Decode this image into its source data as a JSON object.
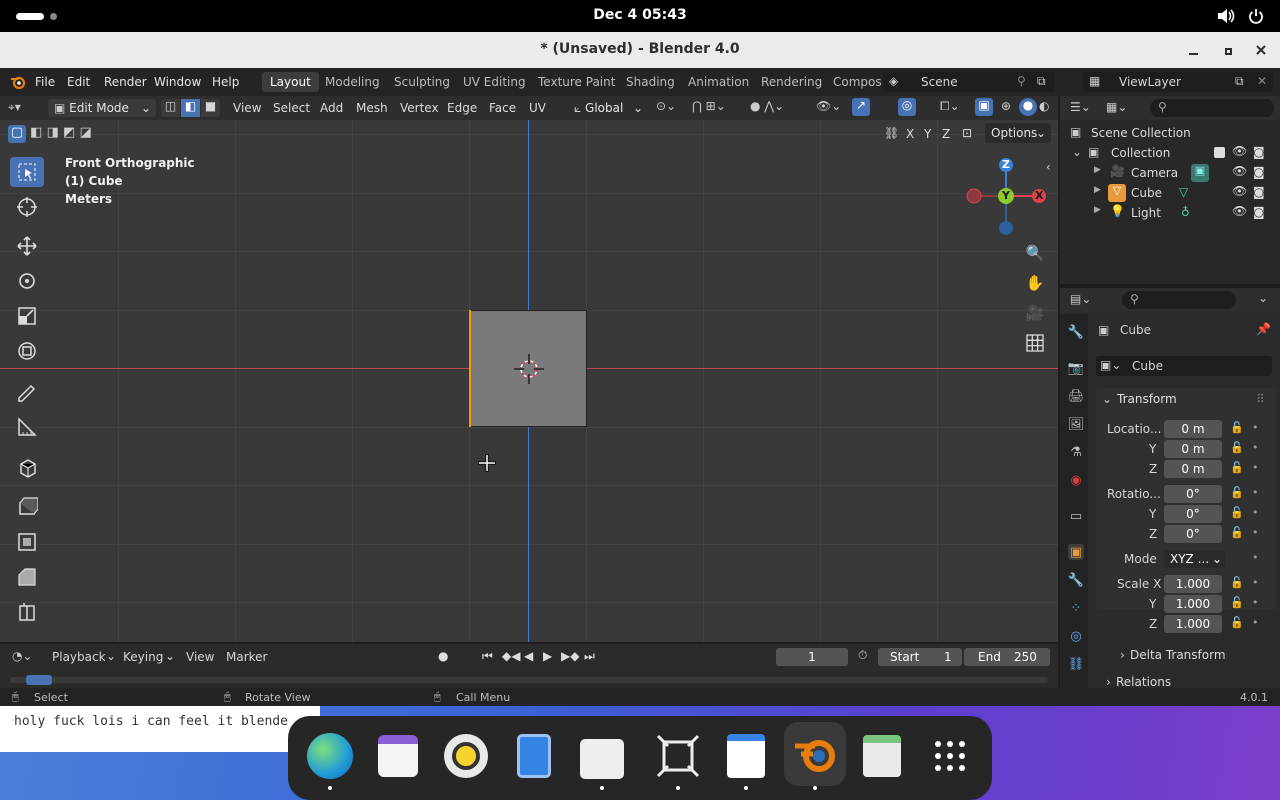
{
  "system_bar": {
    "datetime": "Dec 4  05:43"
  },
  "window": {
    "title": "* (Unsaved) - Blender 4.0"
  },
  "menu": {
    "items": [
      "File",
      "Edit",
      "Render",
      "Window",
      "Help"
    ]
  },
  "workspaces": {
    "tabs": [
      "Layout",
      "Modeling",
      "Sculpting",
      "UV Editing",
      "Texture Paint",
      "Shading",
      "Animation",
      "Rendering",
      "Compos"
    ],
    "active": "Layout"
  },
  "scene": {
    "name": "Scene"
  },
  "view_layer": {
    "name": "ViewLayer"
  },
  "viewport_header": {
    "mode": "Edit Mode",
    "menus": [
      "View",
      "Select",
      "Add",
      "Mesh",
      "Vertex",
      "Edge",
      "Face",
      "UV"
    ],
    "transform_orientation": "Global"
  },
  "viewport": {
    "info_view": "Front Orthographic",
    "info_object": "(1) Cube",
    "info_units": "Meters",
    "axis_lock": [
      "X",
      "Y",
      "Z"
    ],
    "options_label": "Options",
    "gizmo": {
      "z": "Z",
      "y": "Y",
      "x": "X"
    }
  },
  "outliner": {
    "root": "Scene Collection",
    "collection": "Collection",
    "objects": [
      "Camera",
      "Cube",
      "Light"
    ]
  },
  "properties": {
    "object_name": "Cube",
    "data_name": "Cube",
    "transform_label": "Transform",
    "location": {
      "label": "Locatio...",
      "x": "0 m",
      "y": "0 m",
      "z": "0 m"
    },
    "rotation": {
      "label": "Rotatio...",
      "x": "0°",
      "y": "0°",
      "z": "0°"
    },
    "mode_label": "Mode",
    "mode_value": "XYZ ...",
    "scale": {
      "label": "Scale X",
      "x": "1.000",
      "y": "1.000",
      "z": "1.000"
    },
    "axis_y": "Y",
    "axis_z": "Z",
    "delta_transform": "Delta Transform",
    "relations": "Relations"
  },
  "timeline": {
    "menus": [
      "Playback",
      "Keying",
      "View",
      "Marker"
    ],
    "current_frame": "1",
    "start_label": "Start",
    "start_value": "1",
    "end_label": "End",
    "end_value": "250"
  },
  "statusbar": {
    "select": "Select",
    "rotate": "Rotate View",
    "call_menu": "Call Menu",
    "version": "4.0.1"
  },
  "terminal_text": "holy fuck lois i can feel it blende",
  "colors": {
    "accent": "#4772b3",
    "x_axis": "#e0424c",
    "y_axis": "#8ccc2a",
    "z_axis": "#3d7fdc",
    "edge_select": "#f0a000"
  }
}
